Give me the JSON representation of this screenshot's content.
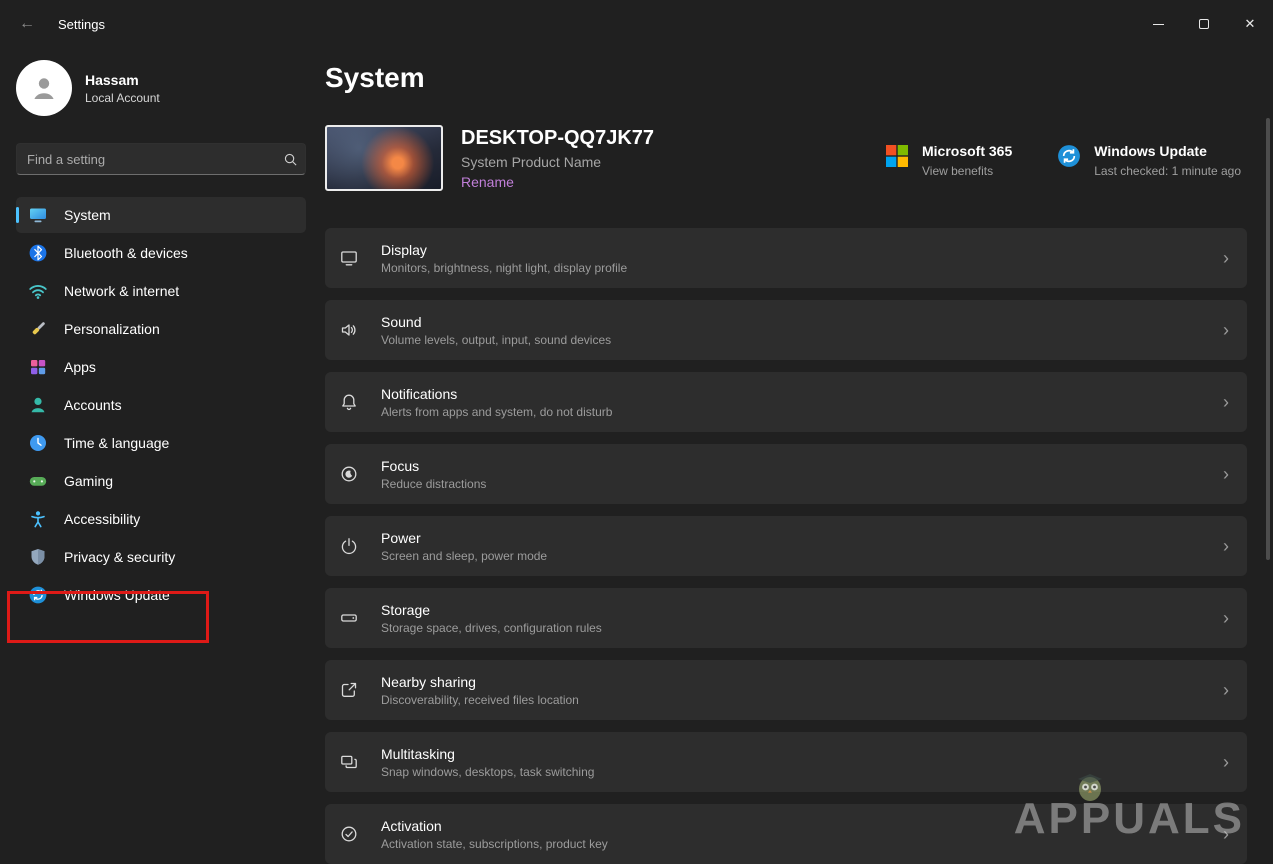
{
  "titlebar": {
    "title": "Settings"
  },
  "icons": {
    "back_arrow": "←",
    "close": "✕",
    "chevron_right": "›"
  },
  "user": {
    "name": "Hassam",
    "account_type": "Local Account"
  },
  "search": {
    "placeholder": "Find a setting"
  },
  "sidebar": {
    "items": [
      {
        "label": "System",
        "icon": "system-icon",
        "selected": true
      },
      {
        "label": "Bluetooth & devices",
        "icon": "bluetooth-icon"
      },
      {
        "label": "Network & internet",
        "icon": "network-icon"
      },
      {
        "label": "Personalization",
        "icon": "personalization-icon"
      },
      {
        "label": "Apps",
        "icon": "apps-icon"
      },
      {
        "label": "Accounts",
        "icon": "accounts-icon"
      },
      {
        "label": "Time & language",
        "icon": "time-language-icon"
      },
      {
        "label": "Gaming",
        "icon": "gaming-icon"
      },
      {
        "label": "Accessibility",
        "icon": "accessibility-icon"
      },
      {
        "label": "Privacy & security",
        "icon": "privacy-icon"
      },
      {
        "label": "Windows Update",
        "icon": "windows-update-icon",
        "highlighted": true
      }
    ]
  },
  "main": {
    "page_title": "System",
    "device": {
      "name": "DESKTOP-QQ7JK77",
      "product": "System Product Name",
      "rename_label": "Rename"
    },
    "quick_links": [
      {
        "title": "Microsoft 365",
        "subtitle": "View benefits",
        "icon": "microsoft-365-icon"
      },
      {
        "title": "Windows Update",
        "subtitle": "Last checked: 1 minute ago",
        "icon": "windows-update-icon"
      }
    ],
    "rows": [
      {
        "title": "Display",
        "subtitle": "Monitors, brightness, night light, display profile",
        "icon": "display-icon"
      },
      {
        "title": "Sound",
        "subtitle": "Volume levels, output, input, sound devices",
        "icon": "sound-icon"
      },
      {
        "title": "Notifications",
        "subtitle": "Alerts from apps and system, do not disturb",
        "icon": "notifications-icon"
      },
      {
        "title": "Focus",
        "subtitle": "Reduce distractions",
        "icon": "focus-icon"
      },
      {
        "title": "Power",
        "subtitle": "Screen and sleep, power mode",
        "icon": "power-icon"
      },
      {
        "title": "Storage",
        "subtitle": "Storage space, drives, configuration rules",
        "icon": "storage-icon"
      },
      {
        "title": "Nearby sharing",
        "subtitle": "Discoverability, received files location",
        "icon": "nearby-sharing-icon"
      },
      {
        "title": "Multitasking",
        "subtitle": "Snap windows, desktops, task switching",
        "icon": "multitasking-icon"
      },
      {
        "title": "Activation",
        "subtitle": "Activation state, subscriptions, product key",
        "icon": "activation-icon"
      }
    ]
  },
  "watermark": {
    "text": "APPUALS"
  },
  "colors": {
    "accent": "#4cc2ff",
    "rename_link": "#c17fd9",
    "highlight_border": "#de1a17",
    "row_background": "#2d2d2d",
    "window_background": "#202020"
  }
}
